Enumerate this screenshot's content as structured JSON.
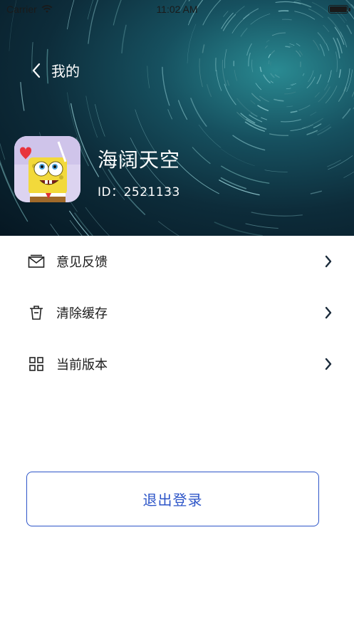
{
  "status_bar": {
    "carrier": "Carrier",
    "time": "11:02 AM"
  },
  "nav": {
    "back_icon": "chevron-left-icon",
    "title": "我的"
  },
  "profile": {
    "name": "海阔天空",
    "id_text": "ID：2521133"
  },
  "menu": {
    "items": [
      {
        "icon": "envelope-icon",
        "label": "意见反馈"
      },
      {
        "icon": "trash-icon",
        "label": "清除缓存"
      },
      {
        "icon": "grid-icon",
        "label": "当前版本"
      }
    ]
  },
  "logout_label": "退出登录",
  "colors": {
    "accent": "#2d55c8",
    "header_dark": "#061722",
    "header_teal": "#2a8a92"
  }
}
